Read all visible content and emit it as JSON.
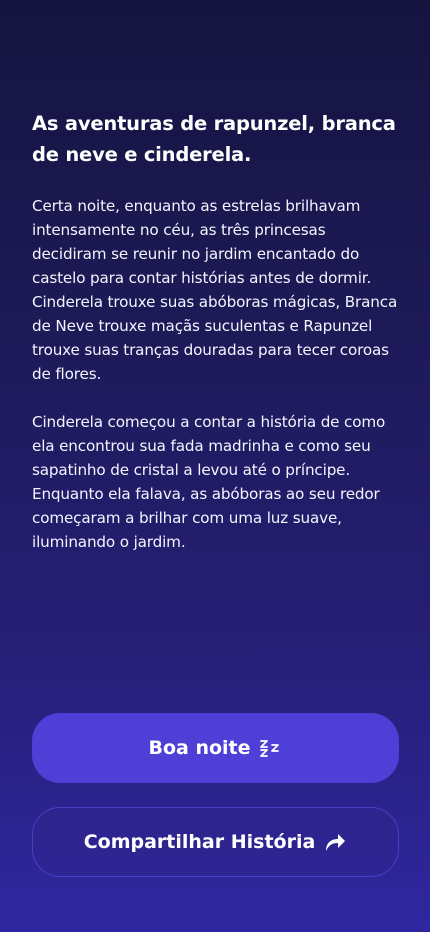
{
  "story": {
    "title": "As aventuras de rapunzel, branca de neve e cinderela.",
    "paragraphs": [
      "Certa noite, enquanto as estrelas brilhavam intensamente no céu, as três princesas decidiram se reunir no jardim encantado do castelo para contar histórias antes de dormir. Cinderela trouxe suas abóboras mágicas, Branca de Neve trouxe maçãs suculentas e Rapunzel trouxe suas tranças douradas para tecer coroas de flores.",
      "Cinderela começou a contar a história de como ela encontrou sua fada madrinha e como seu sapatinho de cristal a levou até o príncipe. Enquanto ela falava, as abóboras ao seu redor começaram a brilhar com uma luz suave, iluminando o jardim."
    ]
  },
  "actions": {
    "goodnight_label": "Boa noite",
    "goodnight_icon": "sleep-zzz-icon",
    "share_label": "Compartilhar História",
    "share_icon": "share-arrow-icon"
  },
  "colors": {
    "background_top": "#15143f",
    "background_bottom": "#2f27a0",
    "primary_button": "#4f3fd6",
    "secondary_button_border": "#4b3ec4"
  }
}
